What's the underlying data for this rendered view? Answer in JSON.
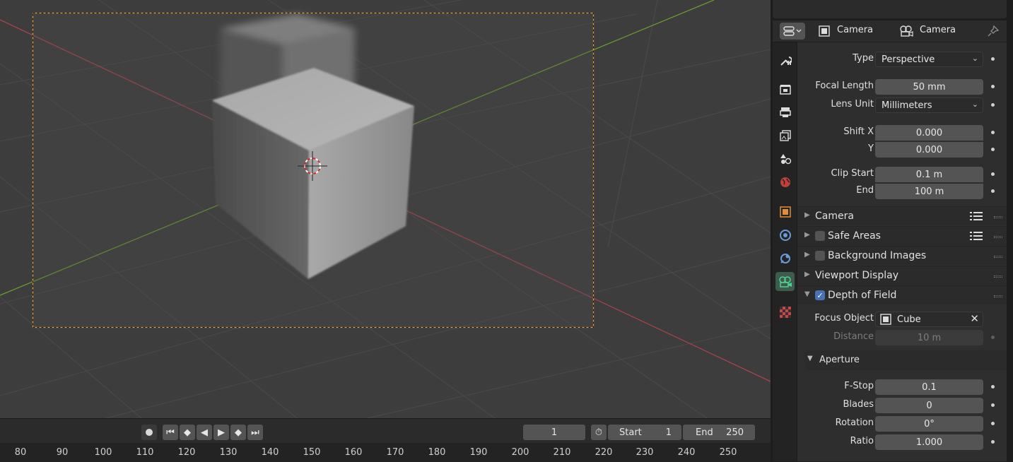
{
  "header": {
    "object_name": "Camera",
    "data_name": "Camera"
  },
  "lens": {
    "type_label": "Type",
    "type_value": "Perspective",
    "focal_length_label": "Focal Length",
    "focal_length_value": "50 mm",
    "lens_unit_label": "Lens Unit",
    "lens_unit_value": "Millimeters",
    "shift_x_label": "Shift X",
    "shift_x_value": "0.000",
    "shift_y_label": "Y",
    "shift_y_value": "0.000",
    "clip_start_label": "Clip Start",
    "clip_start_value": "0.1 m",
    "clip_end_label": "End",
    "clip_end_value": "100 m"
  },
  "sections": {
    "camera": "Camera",
    "safe_areas": "Safe Areas",
    "background_images": "Background Images",
    "viewport_display": "Viewport Display",
    "depth_of_field": "Depth of Field"
  },
  "dof": {
    "focus_object_label": "Focus Object",
    "focus_object_value": "Cube",
    "distance_label": "Distance",
    "distance_value": "10 m",
    "aperture_label": "Aperture",
    "fstop_label": "F-Stop",
    "fstop_value": "0.1",
    "blades_label": "Blades",
    "blades_value": "0",
    "rotation_label": "Rotation",
    "rotation_value": "0°",
    "ratio_label": "Ratio",
    "ratio_value": "1.000"
  },
  "timeline": {
    "current_frame": "1",
    "start_label": "Start",
    "start_value": "1",
    "end_label": "End",
    "end_value": "250",
    "ruler": [
      "80",
      "90",
      "100",
      "110",
      "120",
      "130",
      "140",
      "150",
      "160",
      "170",
      "180",
      "190",
      "200",
      "210",
      "220",
      "230",
      "240",
      "250"
    ]
  },
  "icons": {
    "tabs": [
      "tool-icon",
      "render-icon",
      "output-icon",
      "view-layer-icon",
      "scene-icon",
      "world-icon",
      "object-icon",
      "modifier-icon",
      "physics-icon",
      "camera-data-icon",
      "texture-icon"
    ]
  },
  "colors": {
    "x_axis": "#a8434f",
    "y_axis": "#6a9a2e",
    "camera_frame": "#e8a13a",
    "active_tab": "#3e5b4d",
    "checkbox_on": "#4772b3"
  }
}
